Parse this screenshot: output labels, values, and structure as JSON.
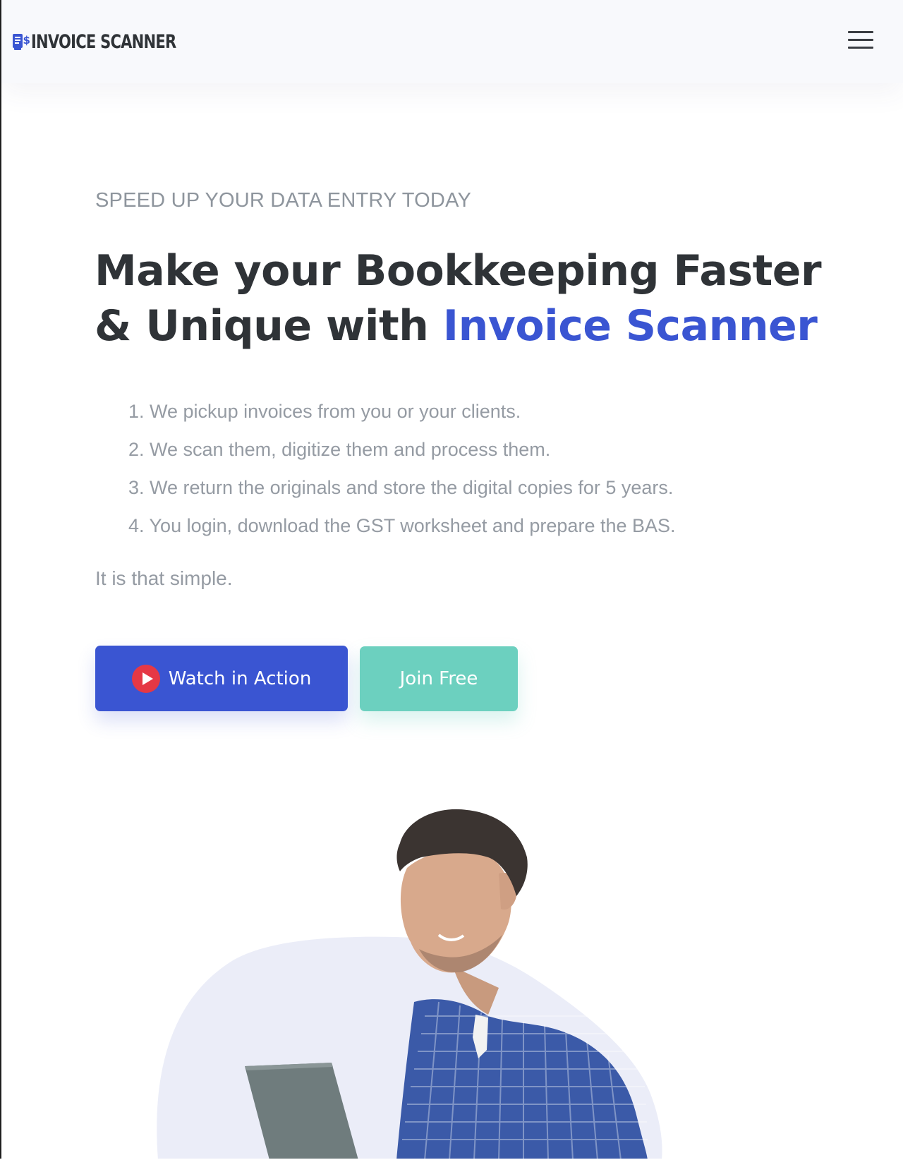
{
  "header": {
    "logo_text": "INVOICE SCANNER",
    "logo_icon": "invoice-dollar-icon",
    "menu_icon": "hamburger-menu-icon"
  },
  "hero": {
    "eyebrow": "SPEED UP YOUR DATA ENTRY TODAY",
    "title_prefix": "Make your Bookkeeping Faster & Unique with ",
    "title_accent": "Invoice Scanner",
    "steps": [
      "1. We pickup invoices from you or your clients.",
      "2. We scan them, digitize them and process them.",
      "3. We return the originals and store the digital copies for 5 years.",
      "4. You login, download the GST worksheet and prepare the BAS."
    ],
    "tagline": "It is that simple.",
    "watch_button_label": "Watch in Action",
    "watch_button_icon": "play-icon",
    "join_button_label": "Join Free"
  },
  "colors": {
    "brand_blue": "#3a55d2",
    "teal": "#6cd0bf",
    "heading": "#2f3337",
    "muted": "#959ba3",
    "play_red": "#e53845",
    "header_bg": "#f8f9fc",
    "blob": "#ebedf8"
  }
}
